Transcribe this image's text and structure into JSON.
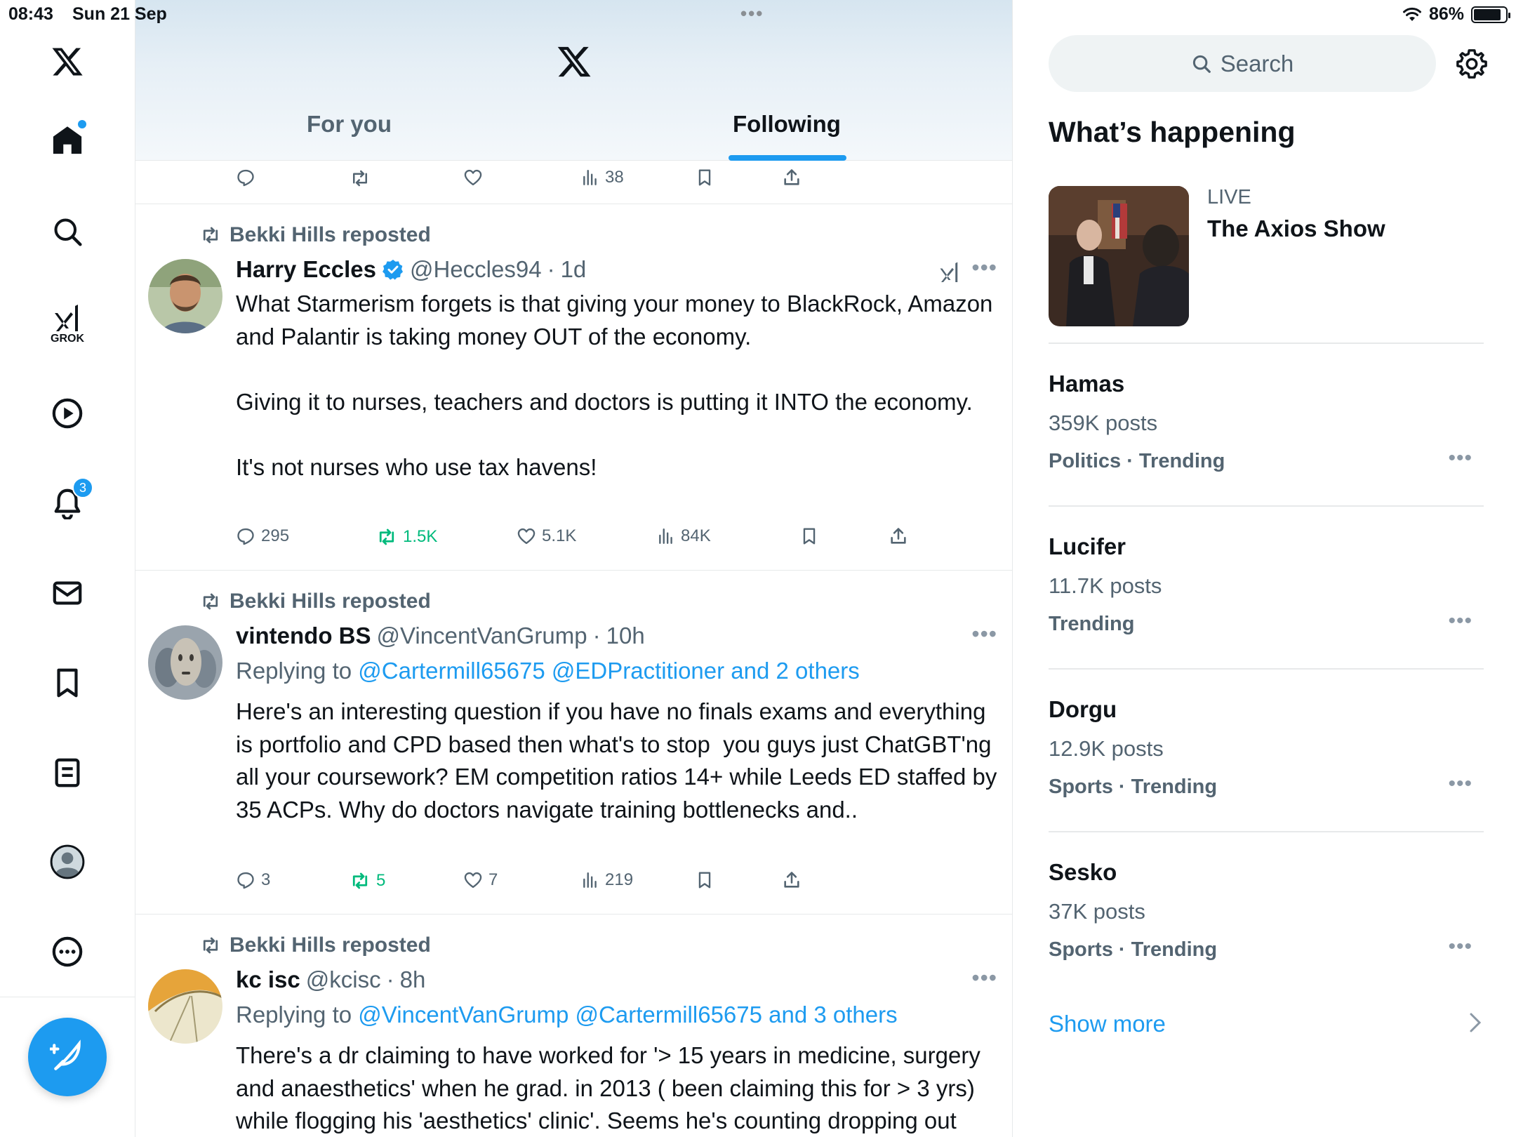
{
  "status_bar": {
    "time": "08:43",
    "date": "Sun 21 Sep",
    "battery": "86%",
    "battery_level": 0.86
  },
  "nav": {
    "grok_label": "GROK",
    "notifications_badge": "3"
  },
  "header": {
    "tabs": [
      {
        "label": "For you",
        "selected": false
      },
      {
        "label": "Following",
        "selected": true
      }
    ]
  },
  "prev_post": {
    "views": "38"
  },
  "posts": [
    {
      "reposted_by": "Bekki Hills reposted",
      "author": "Harry Eccles",
      "verified": true,
      "handle": "@Heccles94",
      "sep": "·",
      "time": "1d",
      "text": "What Starmerism forgets is that giving your money to BlackRock, Amazon and Palantir is taking money OUT of the economy.\n\nGiving it to nurses, teachers and doctors is putting it INTO the economy.\n\nIt's not nurses who use tax havens!",
      "replies": "295",
      "reposts": "1.5K",
      "likes": "5.1K",
      "views": "84K"
    },
    {
      "reposted_by": "Bekki Hills reposted",
      "author": "vintendo BS",
      "handle": "@VincentVanGrump",
      "sep": "·",
      "time": "10h",
      "replying_prefix": "Replying to",
      "replying_to": "@Cartermill65675 @EDPractitioner and 2 others",
      "text": "Here's an interesting question if you have no finals exams and everything is portfolio and CPD based then what's to stop  you guys just ChatGBT'ng all your coursework? EM competition ratios 14+ while Leeds ED staffed by 35 ACPs. Why do doctors navigate training bottlenecks and..",
      "replies": "3",
      "reposts": "5",
      "likes": "7",
      "views": "219"
    },
    {
      "reposted_by": "Bekki Hills reposted",
      "author": "kc isc",
      "handle": "@kcisc",
      "sep": "·",
      "time": "8h",
      "replying_prefix": "Replying to",
      "replying_to": "@VincentVanGrump @Cartermill65675 and 3 others",
      "text": "There's a dr claiming to have worked for '> 15 years in medicine, surgery and anaesthetics' when he grad. in 2013 ( been claiming this for > 3 yrs) while flogging his 'aesthetics' clinic'. Seems he's counting dropping out"
    }
  ],
  "sidebar": {
    "search_placeholder": "Search",
    "whats_happening": "What’s happening",
    "live": {
      "label": "LIVE",
      "title": "The Axios Show"
    },
    "trends": [
      {
        "name": "Hamas",
        "posts": "359K posts",
        "category": "Politics · Trending"
      },
      {
        "name": "Lucifer",
        "posts": "11.7K posts",
        "category": "Trending"
      },
      {
        "name": "Dorgu",
        "posts": "12.9K posts",
        "category": "Sports · Trending"
      },
      {
        "name": "Sesko",
        "posts": "37K posts",
        "category": "Sports · Trending"
      }
    ],
    "show_more": "Show more"
  },
  "colors": {
    "accent": "#1d9bf0",
    "repost_green": "#00ba7c",
    "secondary_text": "#536471"
  }
}
